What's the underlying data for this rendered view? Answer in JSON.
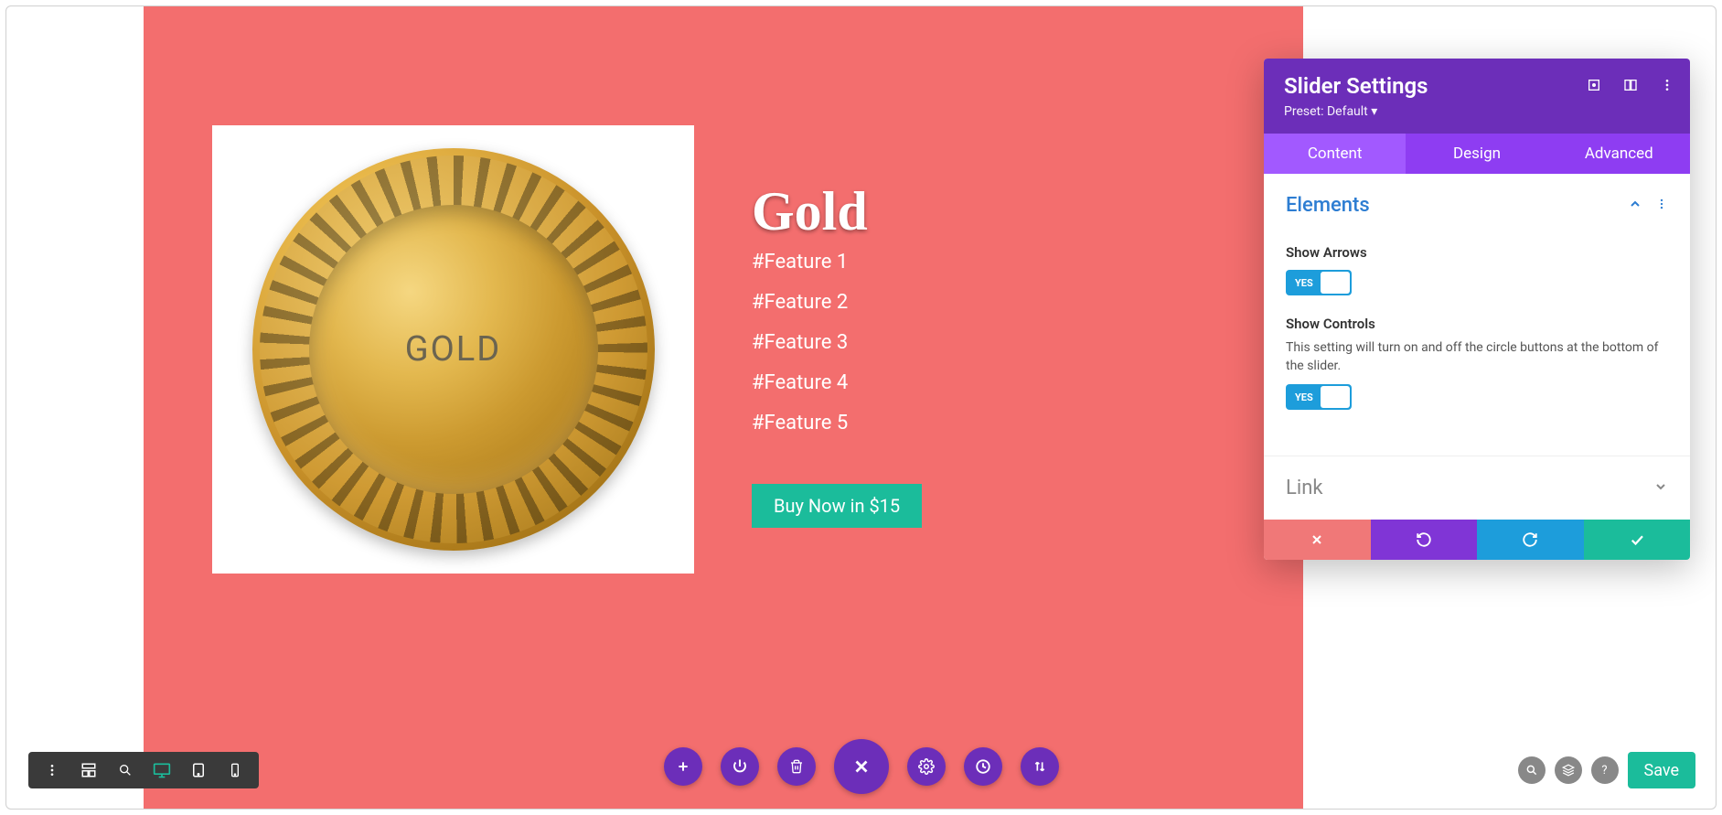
{
  "slide": {
    "title": "Gold",
    "coin_text": "GOLD",
    "features": [
      "#Feature 1",
      "#Feature 2",
      "#Feature 3",
      "#Feature 4",
      "#Feature 5"
    ],
    "buy_label": "Buy Now in $15"
  },
  "panel": {
    "title": "Slider Settings",
    "preset": "Preset: Default ▾",
    "tabs": {
      "content": "Content",
      "design": "Design",
      "advanced": "Advanced"
    },
    "section_elements": "Elements",
    "show_arrows_label": "Show Arrows",
    "show_arrows_value": "YES",
    "show_controls_label": "Show Controls",
    "show_controls_desc": "This setting will turn on and off the circle buttons at the bottom of the slider.",
    "show_controls_value": "YES",
    "link_section": "Link"
  },
  "save_label": "Save"
}
